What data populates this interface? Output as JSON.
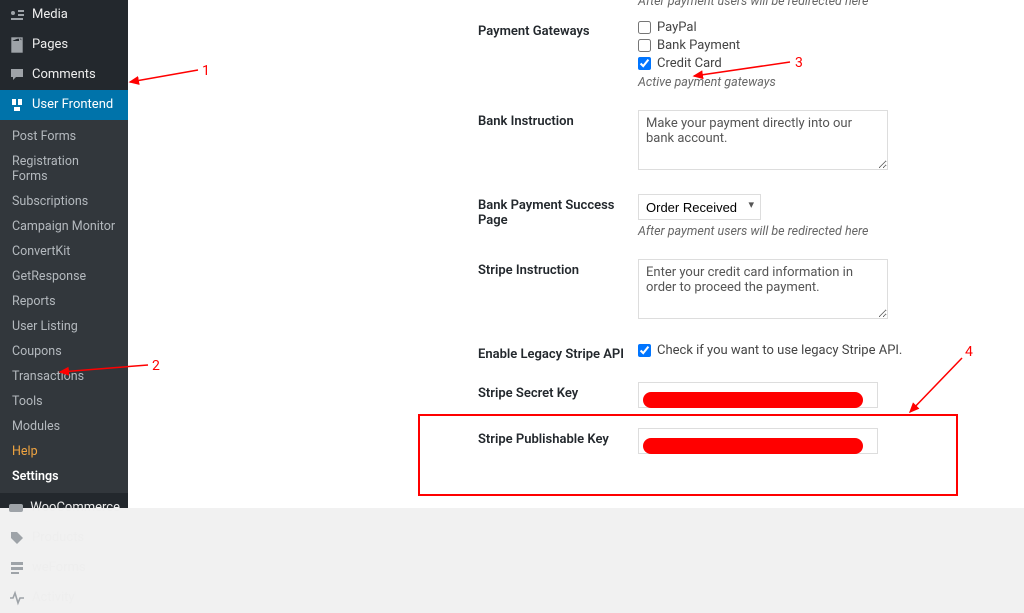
{
  "sidebar": {
    "top": [
      {
        "icon": "media-icon",
        "label": "Media",
        "name": "sidebar-item-media"
      },
      {
        "icon": "page-icon",
        "label": "Pages",
        "name": "sidebar-item-pages"
      },
      {
        "icon": "comments-icon",
        "label": "Comments",
        "name": "sidebar-item-comments"
      }
    ],
    "active": {
      "icon": "userfrontend-icon",
      "label": "User Frontend",
      "name": "sidebar-item-user-frontend"
    },
    "submenu": [
      {
        "label": "Post Forms",
        "name": "submenu-post-forms"
      },
      {
        "label": "Registration Forms",
        "name": "submenu-registration-forms"
      },
      {
        "label": "Subscriptions",
        "name": "submenu-subscriptions"
      },
      {
        "label": "Campaign Monitor",
        "name": "submenu-campaign-monitor"
      },
      {
        "label": "ConvertKit",
        "name": "submenu-convertkit"
      },
      {
        "label": "GetResponse",
        "name": "submenu-getresponse"
      },
      {
        "label": "Reports",
        "name": "submenu-reports"
      },
      {
        "label": "User Listing",
        "name": "submenu-user-listing"
      },
      {
        "label": "Coupons",
        "name": "submenu-coupons"
      },
      {
        "label": "Transactions",
        "name": "submenu-transactions"
      },
      {
        "label": "Tools",
        "name": "submenu-tools"
      },
      {
        "label": "Modules",
        "name": "submenu-modules"
      },
      {
        "label": "Help",
        "name": "submenu-help",
        "highlight": true
      },
      {
        "label": "Settings",
        "name": "submenu-settings",
        "current": true
      }
    ],
    "bottom": [
      {
        "icon": "woocommerce-icon",
        "label": "WooCommerce",
        "name": "sidebar-item-woocommerce"
      },
      {
        "icon": "products-icon",
        "label": "Products",
        "name": "sidebar-item-products"
      },
      {
        "icon": "weforms-icon",
        "label": "weForms",
        "name": "sidebar-item-weforms"
      },
      {
        "icon": "activity-icon",
        "label": "Activity",
        "name": "sidebar-item-activity"
      }
    ]
  },
  "form": {
    "redirect_desc_top": "After payment users will be redirected here",
    "gateways": {
      "label": "Payment Gateways",
      "paypal": "PayPal",
      "bank": "Bank Payment",
      "cc": "Credit Card",
      "desc": "Active payment gateways"
    },
    "bank_instruction": {
      "label": "Bank Instruction",
      "value": "Make your payment directly into our bank account."
    },
    "bank_success": {
      "label": "Bank Payment Success Page",
      "selected": "Order Received",
      "desc": "After payment users will be redirected here"
    },
    "stripe_instruction": {
      "label": "Stripe Instruction",
      "value": "Enter your credit card information in order to proceed the payment."
    },
    "legacy": {
      "label": "Enable Legacy Stripe API",
      "text": "Check if you want to use legacy Stripe API."
    },
    "secret": {
      "label": "Stripe Secret Key"
    },
    "publishable": {
      "label": "Stripe Publishable Key"
    }
  },
  "annotations": {
    "n1": "1",
    "n2": "2",
    "n3": "3",
    "n4": "4"
  }
}
